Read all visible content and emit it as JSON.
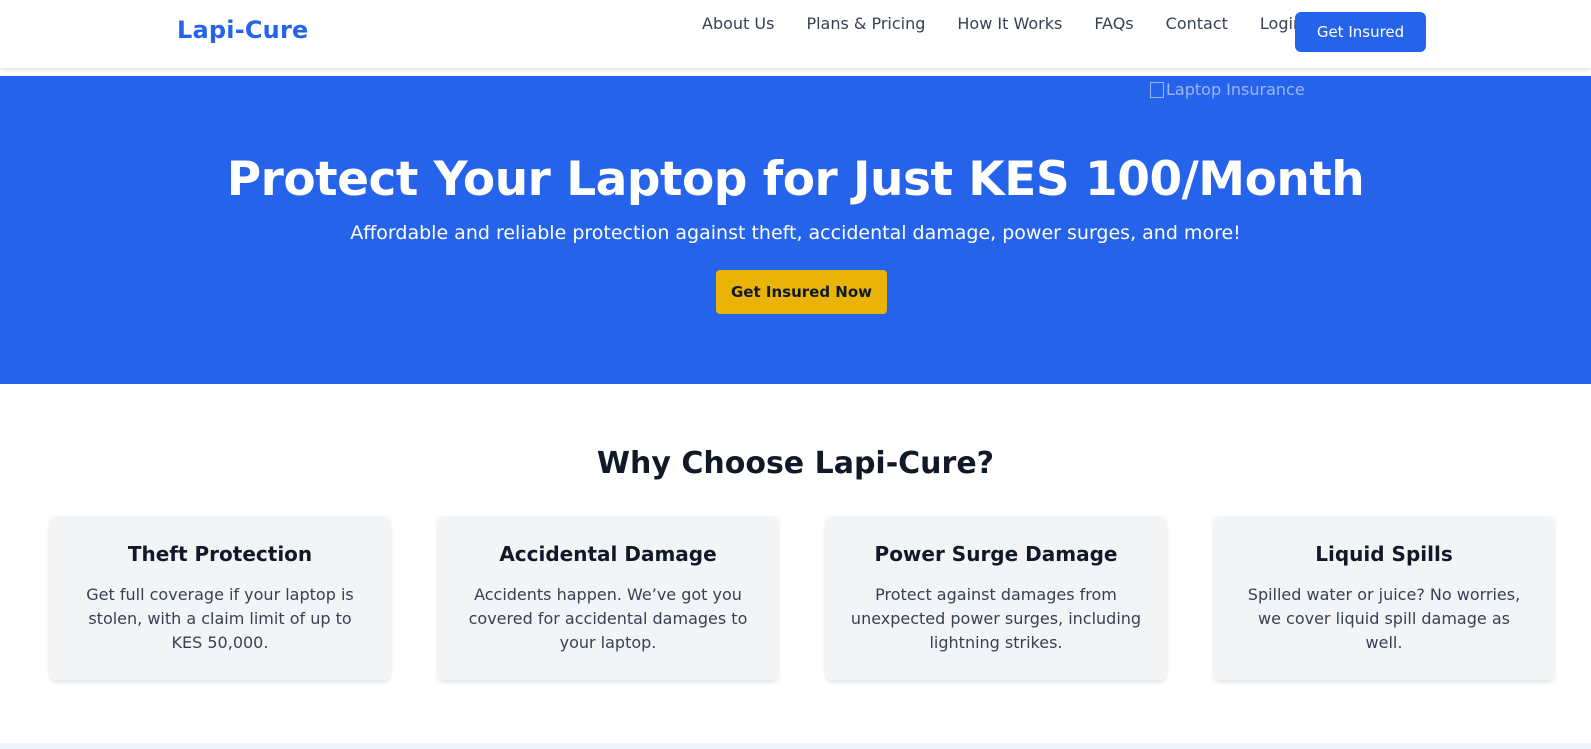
{
  "header": {
    "brand": "Lapi-Cure",
    "nav": [
      "About Us",
      "Plans & Pricing",
      "How It Works",
      "FAQs",
      "Contact",
      "Login"
    ],
    "cta_label": "Get Insured"
  },
  "hero": {
    "image_alt": "Laptop Insurance",
    "title": "Protect Your Laptop for Just KES 100/Month",
    "subtitle": "Affordable and reliable protection against theft, accidental damage, power surges, and more!",
    "cta_label": "Get Insured Now"
  },
  "features": {
    "title": "Why Choose Lapi-Cure?",
    "cards": [
      {
        "title": "Theft Protection",
        "text": "Get full coverage if your laptop is stolen, with a claim limit of up to KES 50,000."
      },
      {
        "title": "Accidental Damage",
        "text": "Accidents happen. We’ve got you covered for accidental damages to your laptop."
      },
      {
        "title": "Power Surge Damage",
        "text": "Protect against damages from unexpected power surges, including lightning strikes."
      },
      {
        "title": "Liquid Spills",
        "text": "Spilled water or juice? No worries, we cover liquid spill damage as well."
      }
    ]
  },
  "colors": {
    "primary": "#2563eb",
    "accent": "#eab308",
    "card_bg": "#f3f4f6"
  }
}
